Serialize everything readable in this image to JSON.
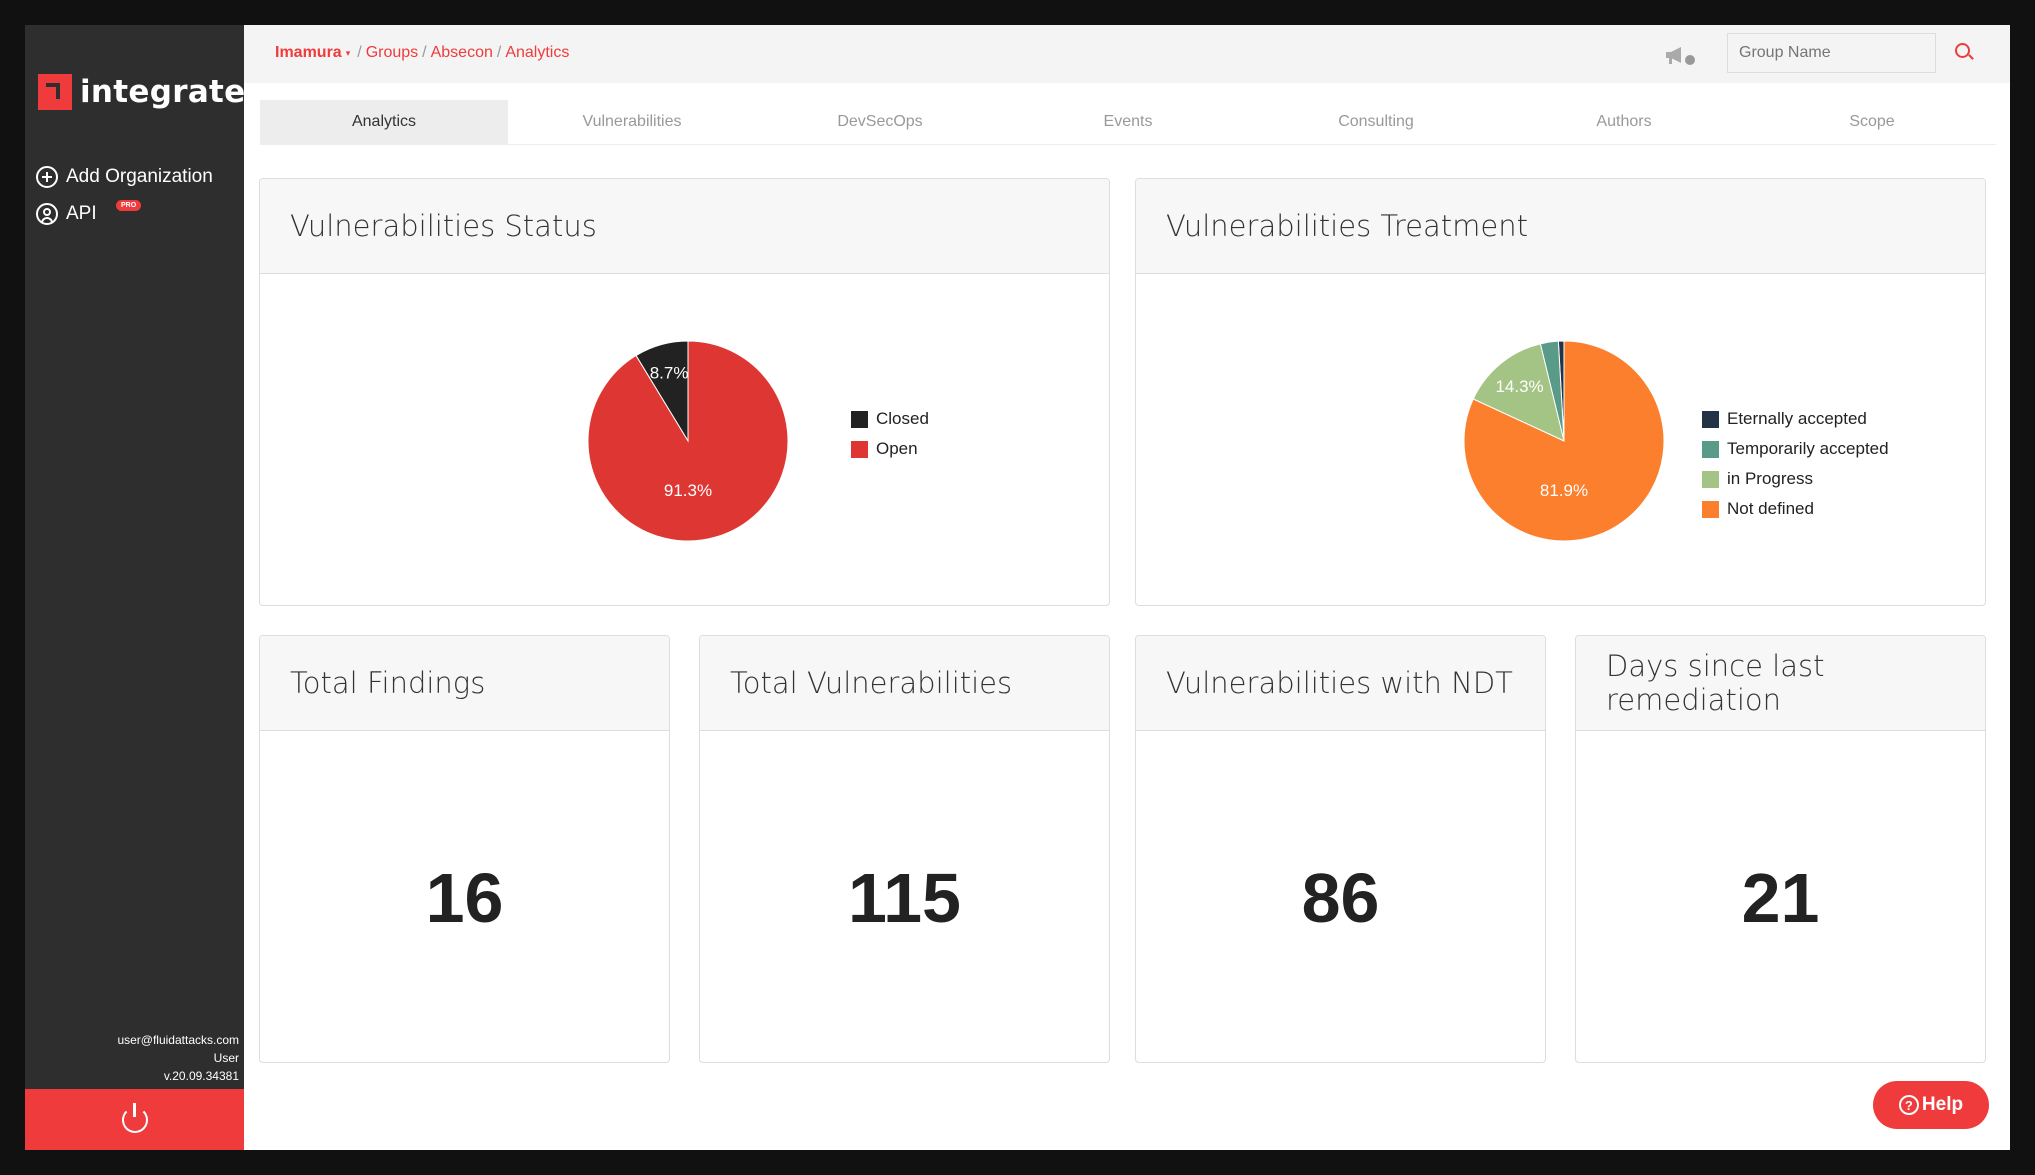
{
  "app": {
    "logo_text": "integrates"
  },
  "sidebar": {
    "items": [
      {
        "label": "Add Organization",
        "icon": "plus-circle-icon"
      },
      {
        "label": "API",
        "icon": "user-circle-icon",
        "badge": "PRO"
      }
    ],
    "user_email": "user@fluidattacks.com",
    "user_role": "User",
    "version": "v.20.09.34381"
  },
  "header": {
    "breadcrumb": {
      "organization": "Imamura",
      "groups": "Groups",
      "group": "Absecon",
      "section": "Analytics"
    },
    "search_placeholder": "Group Name"
  },
  "tabs": [
    {
      "label": "Analytics",
      "active": true
    },
    {
      "label": "Vulnerabilities",
      "active": false
    },
    {
      "label": "DevSecOps",
      "active": false
    },
    {
      "label": "Events",
      "active": false
    },
    {
      "label": "Consulting",
      "active": false
    },
    {
      "label": "Authors",
      "active": false
    },
    {
      "label": "Scope",
      "active": false
    }
  ],
  "cards": {
    "status": {
      "title": "Vulnerabilities Status"
    },
    "treatment": {
      "title": "Vulnerabilities Treatment"
    },
    "total_findings": {
      "title": "Total Findings",
      "value": "16"
    },
    "total_vulnerabilities": {
      "title": "Total Vulnerabilities",
      "value": "115"
    },
    "vulns_ndt": {
      "title": "Vulnerabilities with NDT",
      "value": "86"
    },
    "days_remediation": {
      "title": "Days since last remediation",
      "value": "21"
    }
  },
  "chart_data": [
    {
      "type": "pie",
      "title": "Vulnerabilities Status",
      "legend": "right",
      "slices": [
        {
          "name": "Closed",
          "value": 8.7,
          "label": "8.7%",
          "color": "#222222"
        },
        {
          "name": "Open",
          "value": 91.3,
          "label": "91.3%",
          "color": "#de3733"
        }
      ]
    },
    {
      "type": "pie",
      "title": "Vulnerabilities Treatment",
      "legend": "right",
      "slices": [
        {
          "name": "Eternally accepted",
          "value": 0.9,
          "label": "",
          "color": "#243447"
        },
        {
          "name": "Temporarily accepted",
          "value": 2.9,
          "label": "",
          "color": "#5a9a88"
        },
        {
          "name": "in Progress",
          "value": 14.3,
          "label": "14.3%",
          "color": "#a4c485"
        },
        {
          "name": "Not defined",
          "value": 81.9,
          "label": "81.9%",
          "color": "#fb7f2d"
        }
      ]
    }
  ],
  "help": {
    "label": "Help"
  }
}
